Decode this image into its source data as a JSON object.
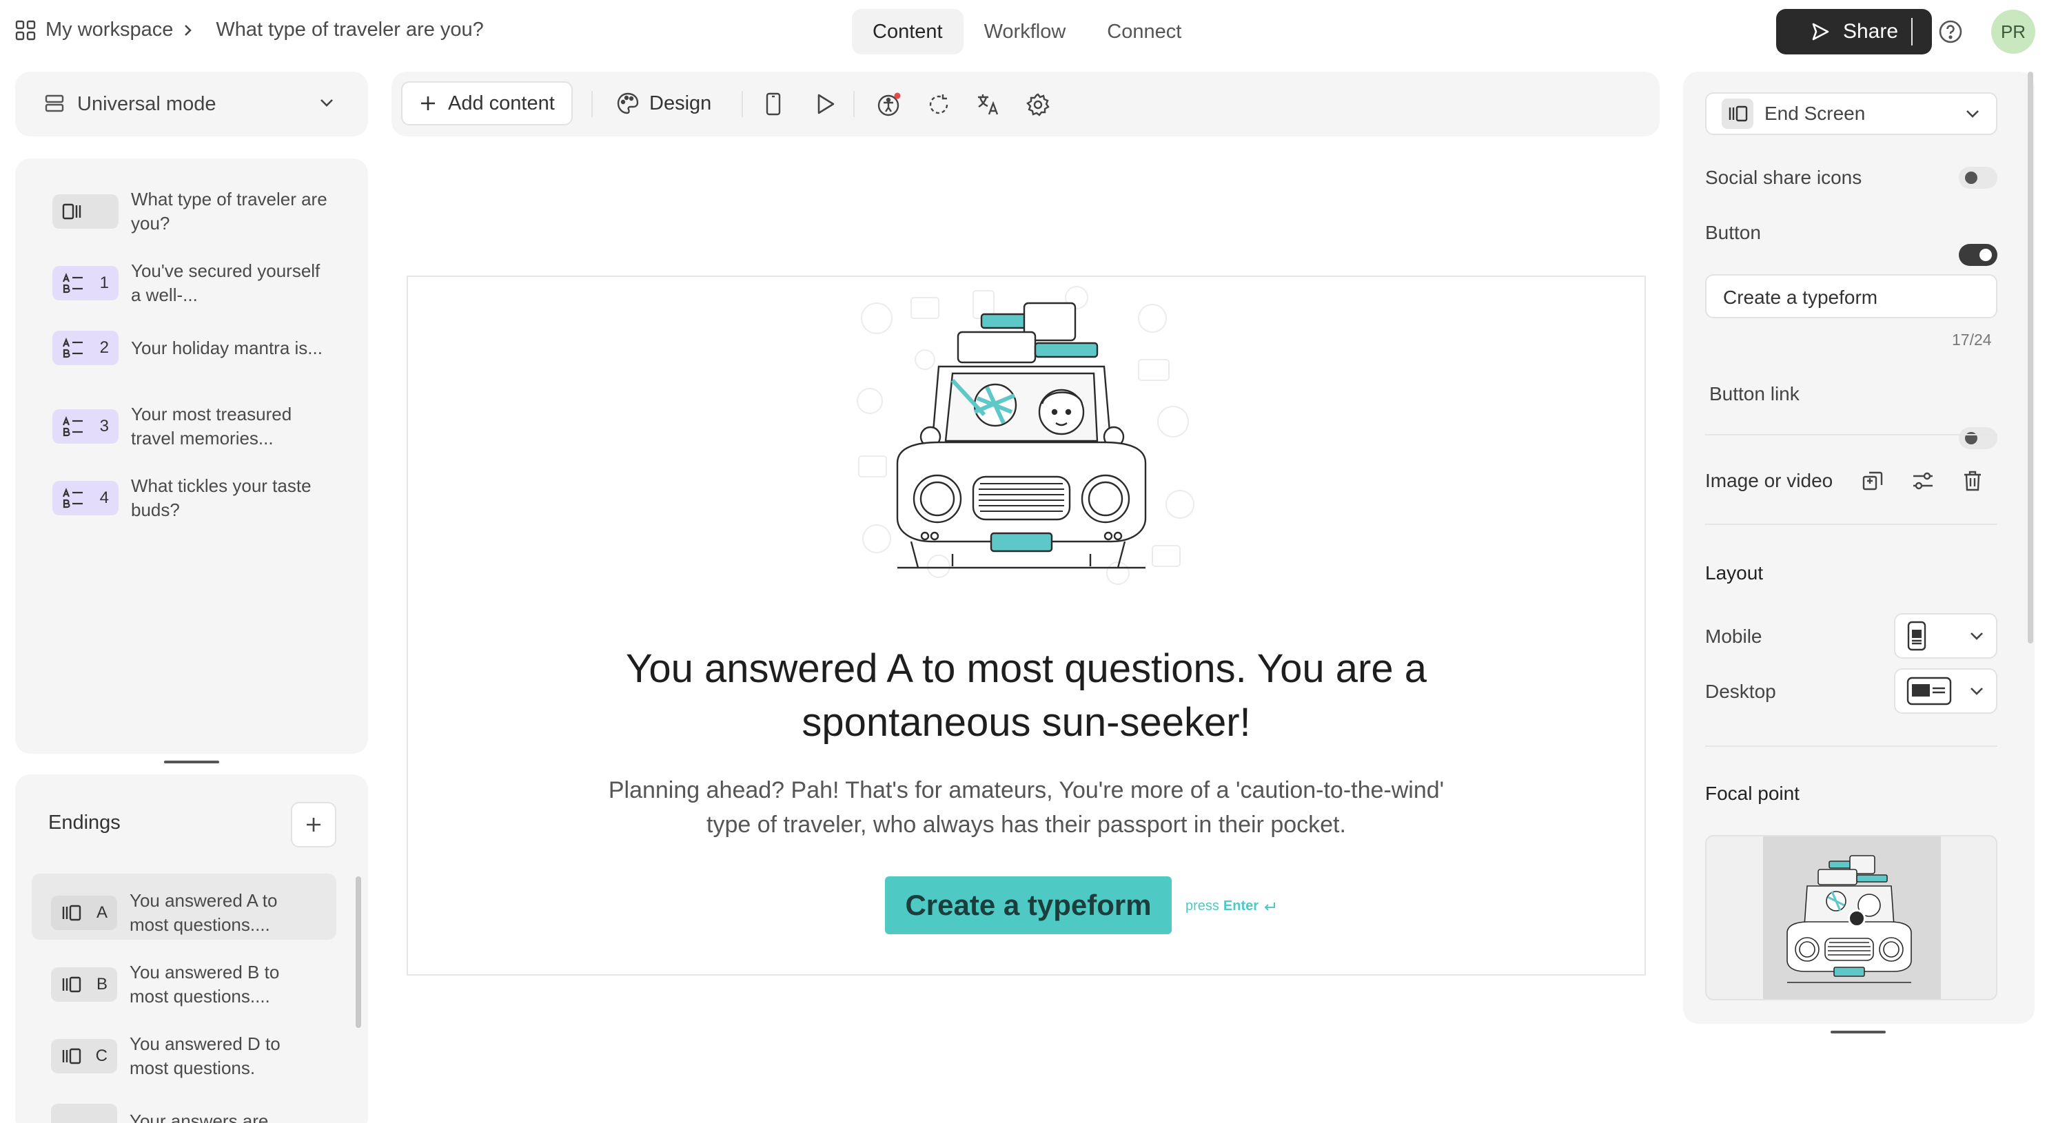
{
  "topbar": {
    "workspace": "My workspace",
    "form_title": "What type of traveler are you?",
    "tabs": [
      {
        "label": "Content",
        "active": true
      },
      {
        "label": "Workflow",
        "active": false
      },
      {
        "label": "Connect",
        "active": false
      }
    ],
    "share_label": "Share",
    "avatar_initials": "PR"
  },
  "mode": {
    "label": "Universal mode"
  },
  "toolbar": {
    "add_content_label": "Add content",
    "design_label": "Design"
  },
  "questions": [
    {
      "badge": "",
      "type": "welcome",
      "text": "What type of traveler are you?"
    },
    {
      "badge": "1",
      "type": "multiple-choice",
      "text": "You've secured yourself a well-..."
    },
    {
      "badge": "2",
      "type": "multiple-choice",
      "text": "Your holiday mantra is..."
    },
    {
      "badge": "3",
      "type": "multiple-choice",
      "text": "Your most treasured travel memories..."
    },
    {
      "badge": "4",
      "type": "multiple-choice",
      "text": "What tickles your taste buds?"
    }
  ],
  "endings": {
    "title": "Endings",
    "items": [
      {
        "badge": "A",
        "text": "You answered A to most questions....",
        "selected": true
      },
      {
        "badge": "B",
        "text": "You answered B to most questions....",
        "selected": false
      },
      {
        "badge": "C",
        "text": "You answered D to most questions.",
        "selected": false
      },
      {
        "badge": "",
        "text": "Your answers are",
        "selected": false
      }
    ]
  },
  "preview": {
    "title": "You answered A to most questions. You are a spontaneous sun-seeker!",
    "description": "Planning ahead? Pah! That's for amateurs, You're more of a 'caution-to-the-wind' type of traveler, who always has their passport in their pocket.",
    "button_label": "Create a typeform",
    "hint_press": "press",
    "hint_key": "Enter"
  },
  "settings": {
    "screen_type": "End Screen",
    "social_share_label": "Social share icons",
    "social_share_on": false,
    "button_label": "Button",
    "button_on": true,
    "button_text_value": "Create a typeform",
    "char_count": "17/24",
    "button_link_label": "Button link",
    "button_link_on": false,
    "image_video_label": "Image or video",
    "layout_title": "Layout",
    "mobile_label": "Mobile",
    "desktop_label": "Desktop",
    "focal_point_title": "Focal point"
  },
  "colors": {
    "accent": "#4fc9c4",
    "share_bg": "#2a2a2a",
    "badge_purple": "#e4dcfb",
    "panel_bg": "#f5f5f5"
  }
}
